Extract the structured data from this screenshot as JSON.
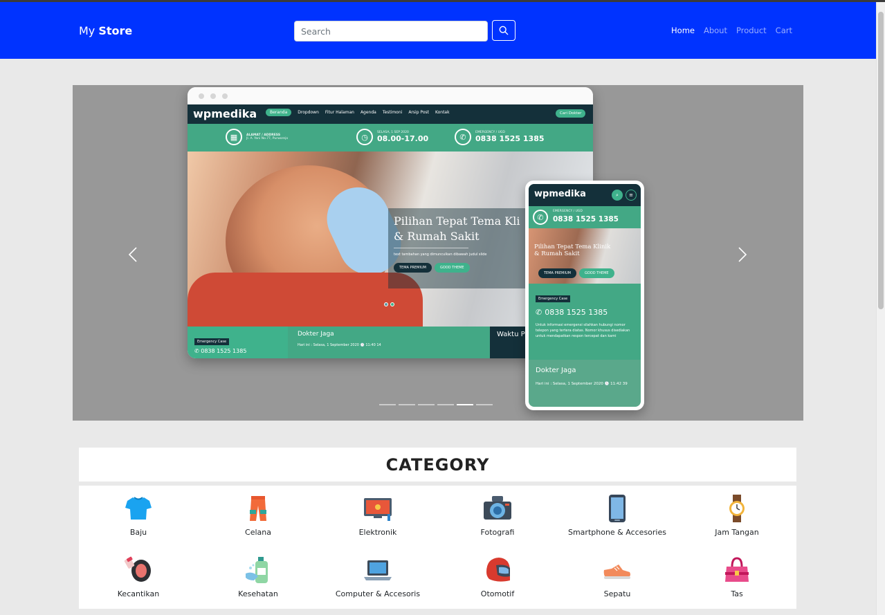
{
  "navbar": {
    "brand_prefix": "My",
    "brand_strong": "Store",
    "search_placeholder": "Search",
    "links": [
      {
        "label": "Home",
        "active": true
      },
      {
        "label": "About",
        "active": false
      },
      {
        "label": "Product",
        "active": false
      },
      {
        "label": "Cart",
        "active": false
      }
    ],
    "colors": {
      "navbar": "#0033ff"
    }
  },
  "carousel": {
    "indicator_count": 6,
    "active_indicator": 5,
    "slide": {
      "logo": "wpmedika",
      "menu": [
        "Beranda",
        "Dropdown",
        "Fitur Halaman",
        "Agenda",
        "Testimoni",
        "Arsip Post",
        "Kontak"
      ],
      "search_btn": "Cari Dokter",
      "address_label": "ALAMAT / ADDRESS",
      "address_value": "Jl. A. Yani No.77, Purworejo",
      "date_label": "SELASA, 1 SEP 2020",
      "hours": "08.00-17.00",
      "emergency_label": "EMERGENCY / UGD",
      "emergency_phone": "0838 1525 1385",
      "hero_title_1": "Pilihan Tepat Tema Kli",
      "hero_title_2": "& Rumah Sakit",
      "hero_subtitle": "text tambahan yang dimunculkan dibawah judul slide",
      "btn_premium": "TEMA PREMIUM",
      "btn_good": "GOOD THEME",
      "emergency_case": "Emergency Case",
      "doctor_title": "Dokter Jaga",
      "doctor_today": "Hari ini : Selasa, 1 September 2020 🕒 11:40 14",
      "waktu": "Waktu P",
      "phone_mobile": "0838 1525 1385",
      "mobile_hero_1": "Pilihan Tepat Tema Klinik",
      "mobile_hero_2": "& Rumah Sakit",
      "mobile_info": "Untuk informasi emergensi silahkan hubungi nomor telepon yang tertera diatas. Nomor khusus disediakan untuk mendapatkan respon tercepat dan kami",
      "mobile_doctor_today": "Hari ini : Selasa, 1 September 2020 🕒 11:42 39"
    }
  },
  "category": {
    "title": "CATEGORY",
    "items": [
      {
        "label": "Baju",
        "icon": "shirt-icon"
      },
      {
        "label": "Celana",
        "icon": "pants-icon"
      },
      {
        "label": "Elektronik",
        "icon": "television-icon"
      },
      {
        "label": "Fotografi",
        "icon": "camera-icon"
      },
      {
        "label": "Smartphone & Accesories",
        "icon": "smartphone-icon"
      },
      {
        "label": "Jam Tangan",
        "icon": "watch-icon"
      },
      {
        "label": "Kecantikan",
        "icon": "makeup-icon"
      },
      {
        "label": "Kesehatan",
        "icon": "hand-sanitizer-icon"
      },
      {
        "label": "Computer & Accesoris",
        "icon": "laptop-icon"
      },
      {
        "label": "Otomotif",
        "icon": "helmet-icon"
      },
      {
        "label": "Sepatu",
        "icon": "sneaker-icon"
      },
      {
        "label": "Tas",
        "icon": "handbag-icon"
      }
    ]
  }
}
